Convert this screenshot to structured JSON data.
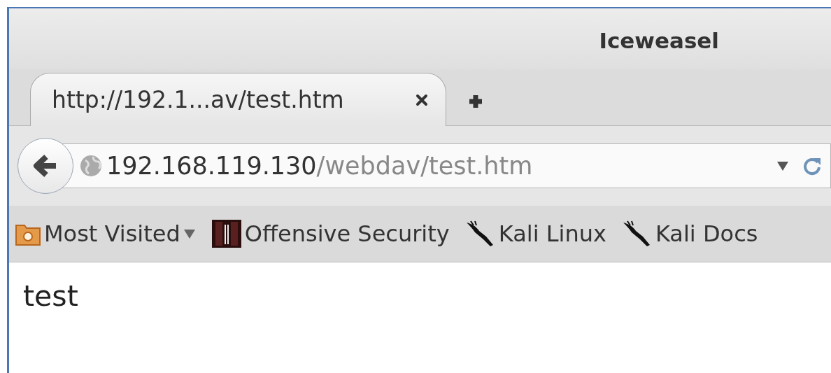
{
  "window": {
    "title": "Iceweasel"
  },
  "tabs": [
    {
      "label": "http://192.1...av/test.htm",
      "selected": true
    }
  ],
  "address_bar": {
    "host": "192.168.119.130",
    "path": "/webdav/test.htm"
  },
  "bookmarks": [
    {
      "label": "Most Visited",
      "kind": "folder"
    },
    {
      "label": "Offensive Security",
      "kind": "offsec"
    },
    {
      "label": "Kali Linux",
      "kind": "kali"
    },
    {
      "label": "Kali Docs",
      "kind": "kali"
    }
  ],
  "page": {
    "text": "test"
  }
}
